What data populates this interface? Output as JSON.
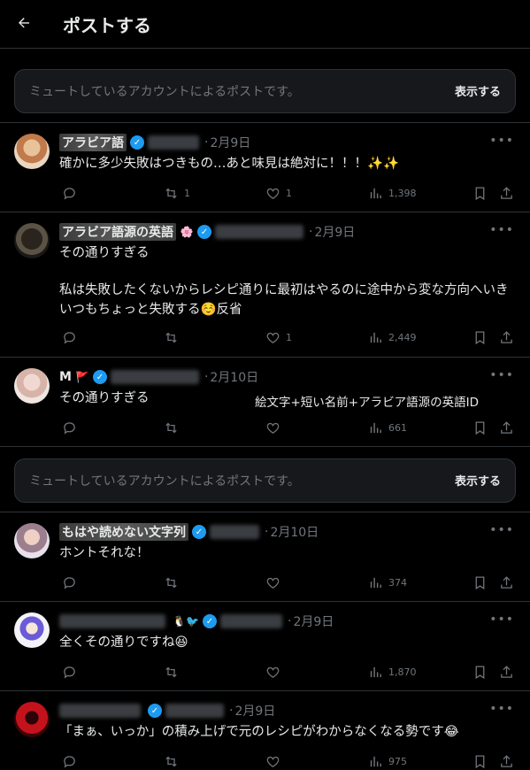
{
  "header": {
    "title": "ポストする",
    "back_icon": "arrow-left-icon"
  },
  "muted_notice": {
    "text": "ミュートしているアカウントによるポストです。",
    "button": "表示する"
  },
  "annotation": "絵文字+短い名前+アラビア語源の英語ID",
  "posts": [
    {
      "name": "アラビア語",
      "date": "2月9日",
      "text": "確かに多少失敗はつきもの…あと味見は絶対に！！！✨✨",
      "replies": "",
      "reposts": "1",
      "likes": "1",
      "views": "1,398"
    },
    {
      "name": "アラビア語源の英語",
      "name_emoji": "🌸",
      "date": "2月9日",
      "text_line1": "その通りすぎる",
      "text_line2": "私は失敗したくないからレシピ通りに最初はやるのに途中から変な方向へいきいつもちょっと失敗する☺️反省",
      "replies": "",
      "reposts": "",
      "likes": "1",
      "views": "2,449"
    },
    {
      "name": "M",
      "name_emoji": "🚩",
      "date": "2月10日",
      "text": "その通りすぎる",
      "replies": "",
      "reposts": "",
      "likes": "",
      "views": "661"
    },
    {
      "name": "もはや読めない文字列",
      "date": "2月10日",
      "text": "ホントそれな！",
      "replies": "",
      "reposts": "",
      "likes": "",
      "views": "374"
    },
    {
      "name": "",
      "name_emoji": "🐧🐦",
      "date": "2月9日",
      "text": "全くその通りですね😆",
      "replies": "",
      "reposts": "",
      "likes": "",
      "views": "1,870"
    },
    {
      "name": "",
      "date": "2月9日",
      "text": "「まぁ、いっか」の積み上げで元のレシピがわからなくなる勢です😂",
      "views": "975"
    }
  ]
}
